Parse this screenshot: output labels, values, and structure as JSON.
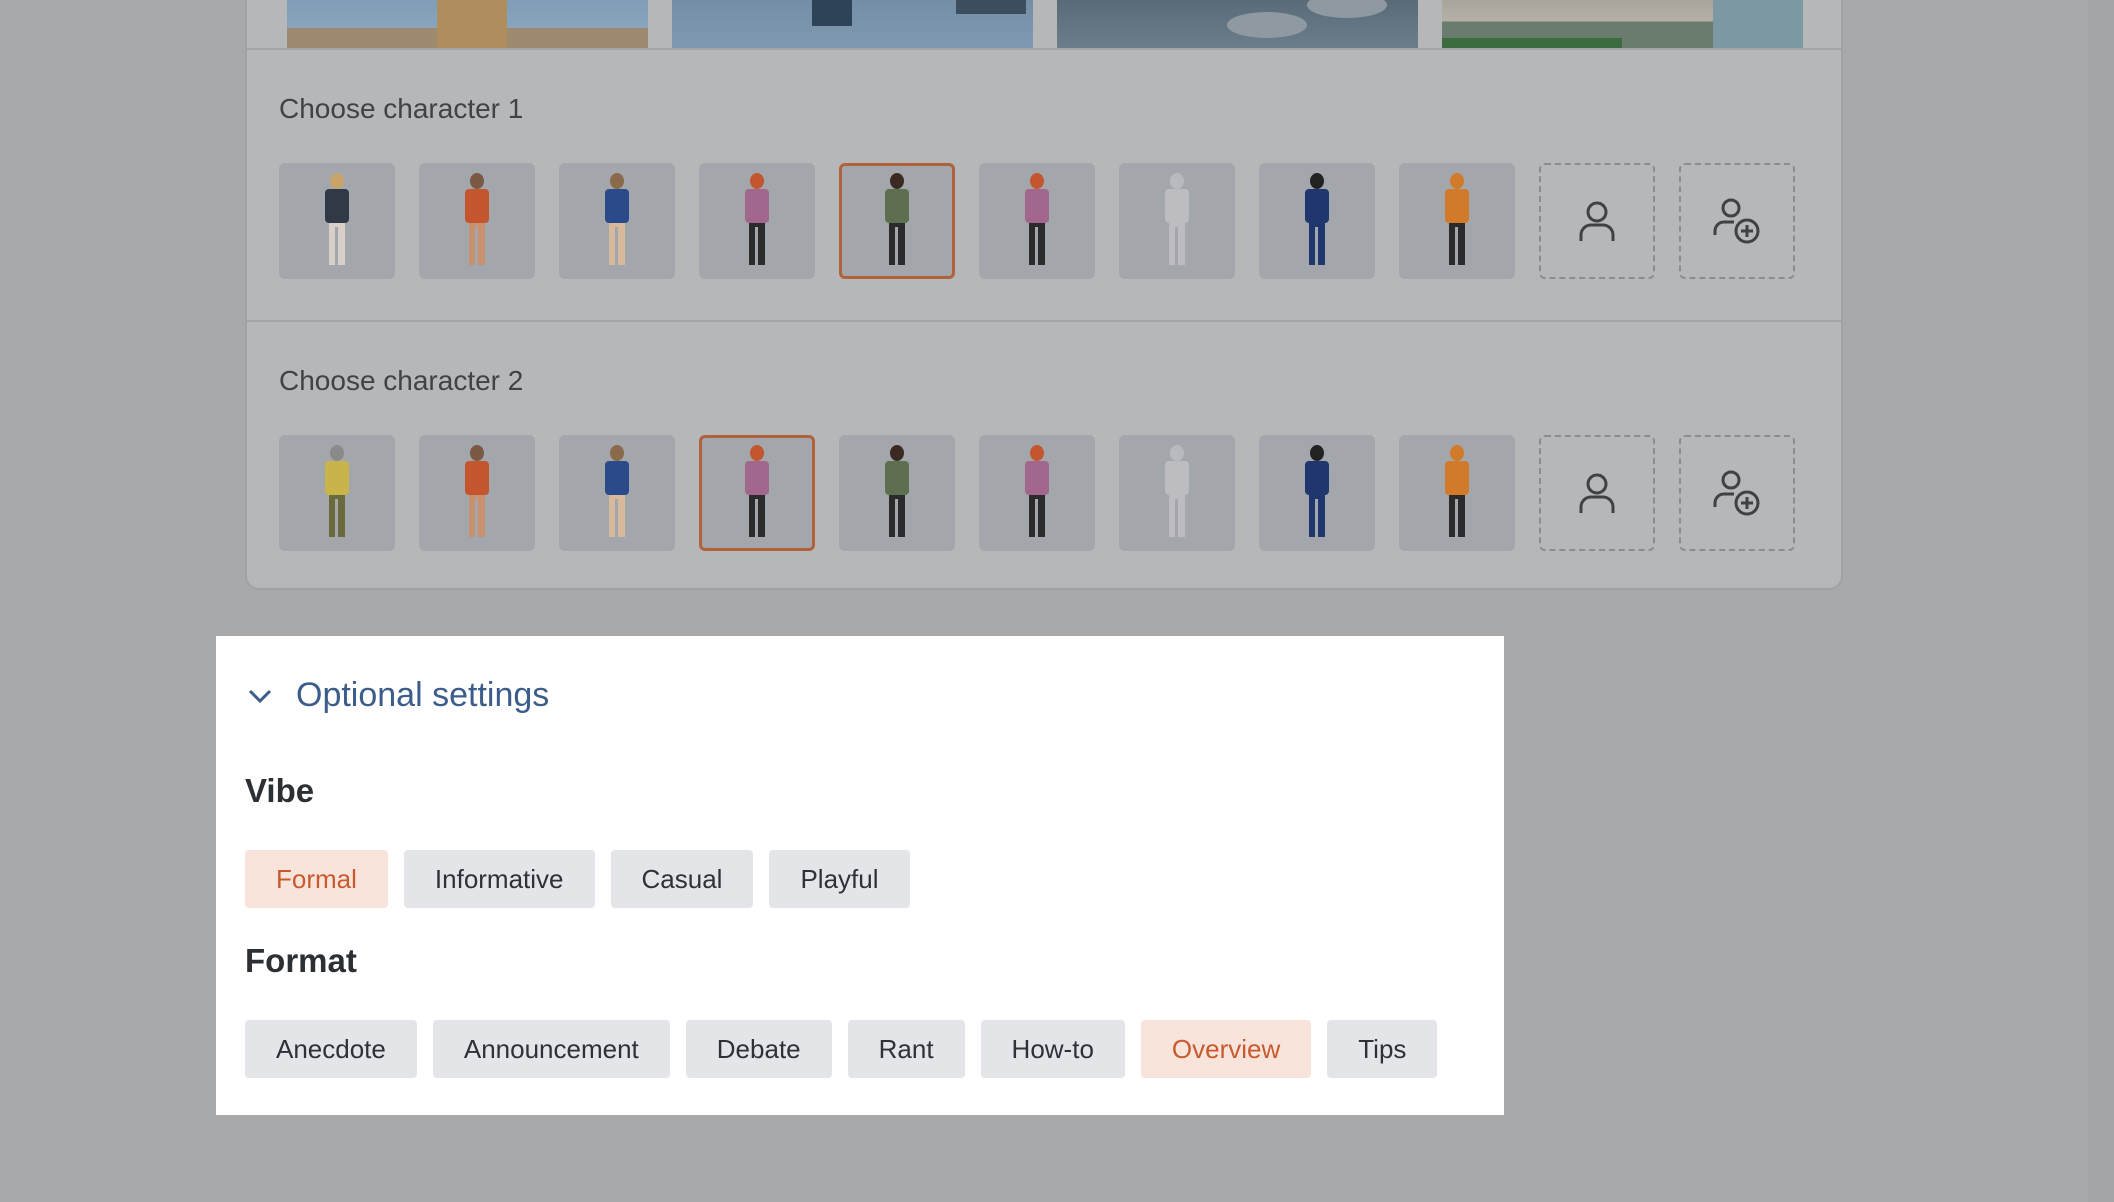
{
  "characters_card": {
    "character1_label": "Choose character 1",
    "character2_label": "Choose character 2",
    "character1_selected_index": 4,
    "character2_selected_index": 3,
    "character_colors": [
      "#2f3a46",
      "#c4562f",
      "#2b4a8a",
      "#a2678c",
      "#5d6f4f",
      "#a2678c",
      "#d9d3d8",
      "#20366f",
      "#d07a2a"
    ],
    "character2_first_color": "#c9b44a"
  },
  "optional_settings": {
    "title": "Optional settings",
    "vibe": {
      "title": "Vibe",
      "options": [
        "Formal",
        "Informative",
        "Casual",
        "Playful"
      ],
      "selected": "Formal"
    },
    "format": {
      "title": "Format",
      "options": [
        "Anecdote",
        "Announcement",
        "Debate",
        "Rant",
        "How-to",
        "Overview",
        "Tips"
      ],
      "selected": "Overview"
    }
  },
  "colors": {
    "accent": "#c75a2e",
    "accent_bg": "#f9e4dc",
    "link": "#3c5c8a"
  }
}
